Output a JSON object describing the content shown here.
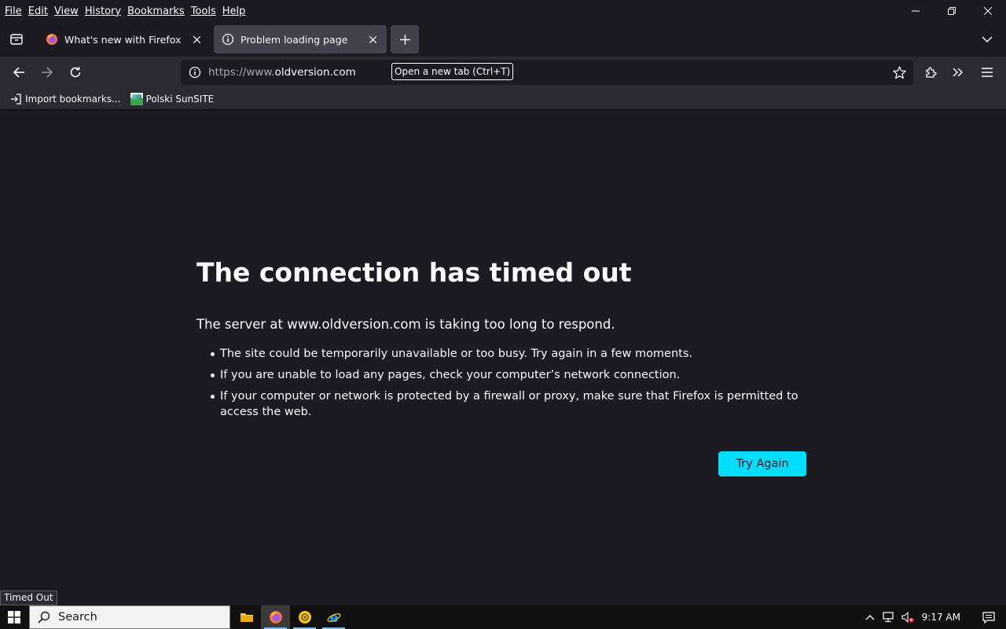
{
  "menubar": {
    "items": [
      {
        "label": "File"
      },
      {
        "label": "Edit"
      },
      {
        "label": "View"
      },
      {
        "label": "History"
      },
      {
        "label": "Bookmarks"
      },
      {
        "label": "Tools"
      },
      {
        "label": "Help"
      }
    ]
  },
  "tabs": [
    {
      "title": "What's new with Firefox",
      "icon": "firefox-icon",
      "active": false
    },
    {
      "title": "Problem loading page",
      "icon": "info-icon",
      "active": true
    }
  ],
  "urlbar": {
    "prefix": "https://www.",
    "domain": "oldversion.com"
  },
  "tooltip": {
    "text": "Open a new tab (Ctrl+T)"
  },
  "bookmarks": [
    {
      "label": "Import bookmarks...",
      "icon": "import-icon"
    },
    {
      "label": "Polski SunSITE",
      "icon": "sunsite-favicon"
    }
  ],
  "error": {
    "title": "The connection has timed out",
    "description": "The server at www.oldversion.com is taking too long to respond.",
    "bullets": [
      "The site could be temporarily unavailable or too busy. Try again in a few moments.",
      "If you are unable to load any pages, check your computer’s network connection.",
      "If your computer or network is protected by a firewall or proxy, make sure that Firefox is permitted to access the web."
    ],
    "try_again_label": "Try Again"
  },
  "status_tip": "Timed Out",
  "taskbar": {
    "search_placeholder": "Search",
    "clock": "9:17 AM",
    "apps": [
      "file-explorer-icon",
      "firefox-icon",
      "app-yellow-icon",
      "internet-explorer-icon"
    ]
  },
  "colors": {
    "accent": "#00ddff",
    "background": "#1c1b22",
    "toolbar": "#2b2a33",
    "active_tab": "#42414d"
  }
}
